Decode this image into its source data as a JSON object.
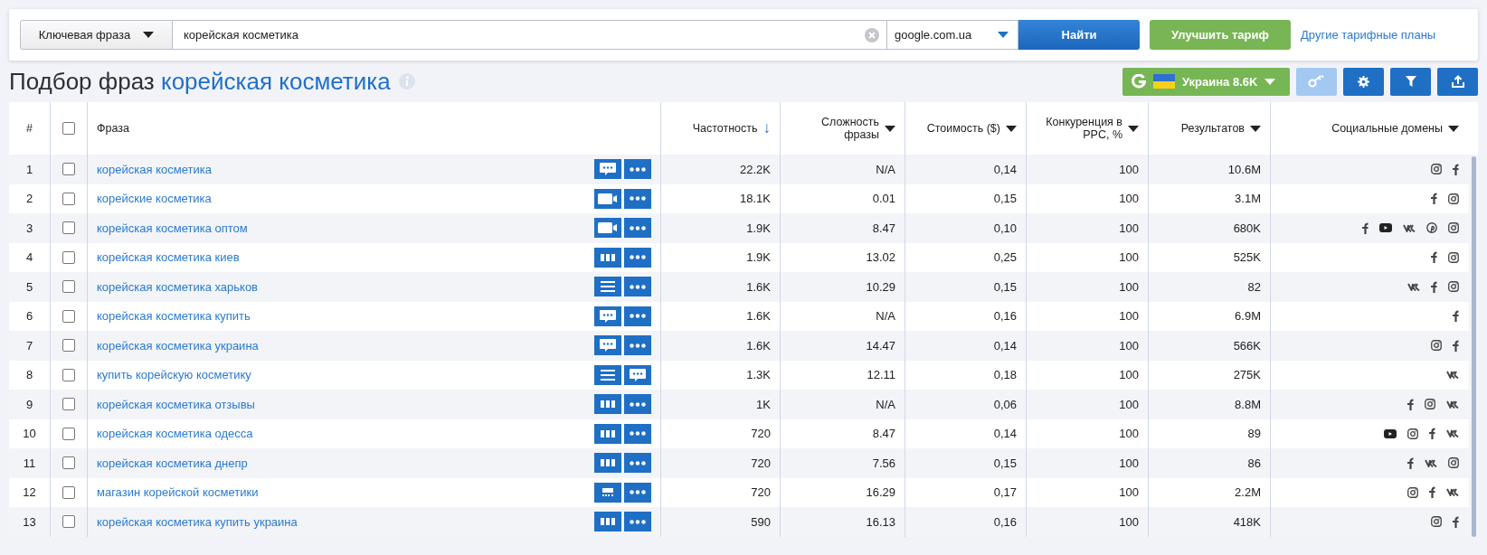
{
  "search_bar": {
    "mode_dropdown": "Ключевая фраза",
    "query": "корейская косметика",
    "engine_dropdown": "google.com.ua",
    "search_button": "Найти",
    "upgrade_button": "Улучшить тариф",
    "plans_link": "Другие тарифные планы"
  },
  "page_title": {
    "prefix": "Подбор фраз",
    "keyword": "корейская косметика"
  },
  "toolbar": {
    "region_button": "Украина 8.6K",
    "buttons": [
      {
        "kind": "key",
        "disabled": true
      },
      {
        "kind": "settings",
        "disabled": false
      },
      {
        "kind": "filter",
        "disabled": false
      },
      {
        "kind": "export",
        "disabled": false
      }
    ]
  },
  "table": {
    "columns": [
      {
        "label": "#"
      },
      {
        "label": "Фраза"
      },
      {
        "label": "Частотность",
        "sort_arrow": "↓"
      },
      {
        "label": "Сложность фразы",
        "menu": true
      },
      {
        "label": "Стоимость ($)",
        "menu": true
      },
      {
        "label": "Конкуренция в PPC, %",
        "menu": true
      },
      {
        "label": "Результатов",
        "menu": true
      },
      {
        "label": "Социальные домены",
        "menu": true
      }
    ],
    "header_checked": false,
    "rows": [
      {
        "n": "1",
        "checked": false,
        "phrase": "корейская косметика",
        "features": [
          {
            "kind": "chat"
          },
          {
            "kind": "more"
          }
        ],
        "volume": "22.2K",
        "difficulty": "N/A",
        "cpc": "0,14",
        "competition": "100",
        "results": "10.6M",
        "social": [
          {
            "kind": "instagram"
          },
          {
            "kind": "facebook"
          }
        ]
      },
      {
        "n": "2",
        "checked": false,
        "phrase": "корейские косметика",
        "features": [
          {
            "kind": "video"
          },
          {
            "kind": "more"
          }
        ],
        "volume": "18.1K",
        "difficulty": "0.01",
        "cpc": "0,15",
        "competition": "100",
        "results": "3.1M",
        "social": [
          {
            "kind": "facebook"
          },
          {
            "kind": "instagram"
          }
        ]
      },
      {
        "n": "3",
        "checked": false,
        "phrase": "корейская косметика оптом",
        "features": [
          {
            "kind": "video"
          },
          {
            "kind": "more"
          }
        ],
        "volume": "1.9K",
        "difficulty": "8.47",
        "cpc": "0,10",
        "competition": "100",
        "results": "680K",
        "social": [
          {
            "kind": "facebook"
          },
          {
            "kind": "youtube"
          },
          {
            "kind": "vk"
          },
          {
            "kind": "pinterest"
          },
          {
            "kind": "instagram"
          }
        ]
      },
      {
        "n": "4",
        "checked": false,
        "phrase": "корейская косметика киев",
        "features": [
          {
            "kind": "bars"
          },
          {
            "kind": "more"
          }
        ],
        "volume": "1.9K",
        "difficulty": "13.02",
        "cpc": "0,25",
        "competition": "100",
        "results": "525K",
        "social": [
          {
            "kind": "facebook"
          },
          {
            "kind": "instagram"
          }
        ]
      },
      {
        "n": "5",
        "checked": false,
        "phrase": "корейская косметика харьков",
        "features": [
          {
            "kind": "list"
          },
          {
            "kind": "more"
          }
        ],
        "volume": "1.6K",
        "difficulty": "10.29",
        "cpc": "0,15",
        "competition": "100",
        "results": "82",
        "social": [
          {
            "kind": "vk"
          },
          {
            "kind": "facebook"
          },
          {
            "kind": "instagram"
          }
        ]
      },
      {
        "n": "6",
        "checked": false,
        "phrase": "корейская косметика купить",
        "features": [
          {
            "kind": "chat"
          },
          {
            "kind": "more"
          }
        ],
        "volume": "1.6K",
        "difficulty": "N/A",
        "cpc": "0,16",
        "competition": "100",
        "results": "6.9M",
        "social": [
          {
            "kind": "facebook"
          }
        ]
      },
      {
        "n": "7",
        "checked": false,
        "phrase": "корейская косметика украина",
        "features": [
          {
            "kind": "chat"
          },
          {
            "kind": "more"
          }
        ],
        "volume": "1.6K",
        "difficulty": "14.47",
        "cpc": "0,14",
        "competition": "100",
        "results": "566K",
        "social": [
          {
            "kind": "instagram"
          },
          {
            "kind": "facebook"
          }
        ]
      },
      {
        "n": "8",
        "checked": false,
        "phrase": "купить корейскую косметику",
        "features": [
          {
            "kind": "list"
          },
          {
            "kind": "chat"
          }
        ],
        "volume": "1.3K",
        "difficulty": "12.11",
        "cpc": "0,18",
        "competition": "100",
        "results": "275K",
        "social": [
          {
            "kind": "vk"
          }
        ]
      },
      {
        "n": "9",
        "checked": false,
        "phrase": "корейская косметика отзывы",
        "features": [
          {
            "kind": "bars"
          },
          {
            "kind": "more"
          }
        ],
        "volume": "1K",
        "difficulty": "N/A",
        "cpc": "0,06",
        "competition": "100",
        "results": "8.8M",
        "social": [
          {
            "kind": "facebook"
          },
          {
            "kind": "instagram"
          },
          {
            "kind": "vk"
          }
        ]
      },
      {
        "n": "10",
        "checked": false,
        "phrase": "корейская косметика одесса",
        "features": [
          {
            "kind": "bars"
          },
          {
            "kind": "more"
          }
        ],
        "volume": "720",
        "difficulty": "8.47",
        "cpc": "0,14",
        "competition": "100",
        "results": "89",
        "social": [
          {
            "kind": "youtube"
          },
          {
            "kind": "instagram"
          },
          {
            "kind": "facebook"
          },
          {
            "kind": "vk"
          }
        ]
      },
      {
        "n": "11",
        "checked": false,
        "phrase": "корейская косметика днепр",
        "features": [
          {
            "kind": "bars"
          },
          {
            "kind": "more"
          }
        ],
        "volume": "720",
        "difficulty": "7.56",
        "cpc": "0,15",
        "competition": "100",
        "results": "86",
        "social": [
          {
            "kind": "facebook"
          },
          {
            "kind": "vk"
          },
          {
            "kind": "instagram"
          }
        ]
      },
      {
        "n": "12",
        "checked": false,
        "phrase": "магазин корейской косметики",
        "features": [
          {
            "kind": "shop"
          },
          {
            "kind": "more"
          }
        ],
        "volume": "720",
        "difficulty": "16.29",
        "cpc": "0,17",
        "competition": "100",
        "results": "2.2M",
        "social": [
          {
            "kind": "instagram"
          },
          {
            "kind": "facebook"
          },
          {
            "kind": "vk"
          }
        ]
      },
      {
        "n": "13",
        "checked": false,
        "phrase": "корейская косметика купить украина",
        "features": [
          {
            "kind": "bars"
          },
          {
            "kind": "more"
          }
        ],
        "volume": "590",
        "difficulty": "16.13",
        "cpc": "0,16",
        "competition": "100",
        "results": "418K",
        "social": [
          {
            "kind": "instagram"
          },
          {
            "kind": "facebook"
          }
        ]
      }
    ]
  }
}
